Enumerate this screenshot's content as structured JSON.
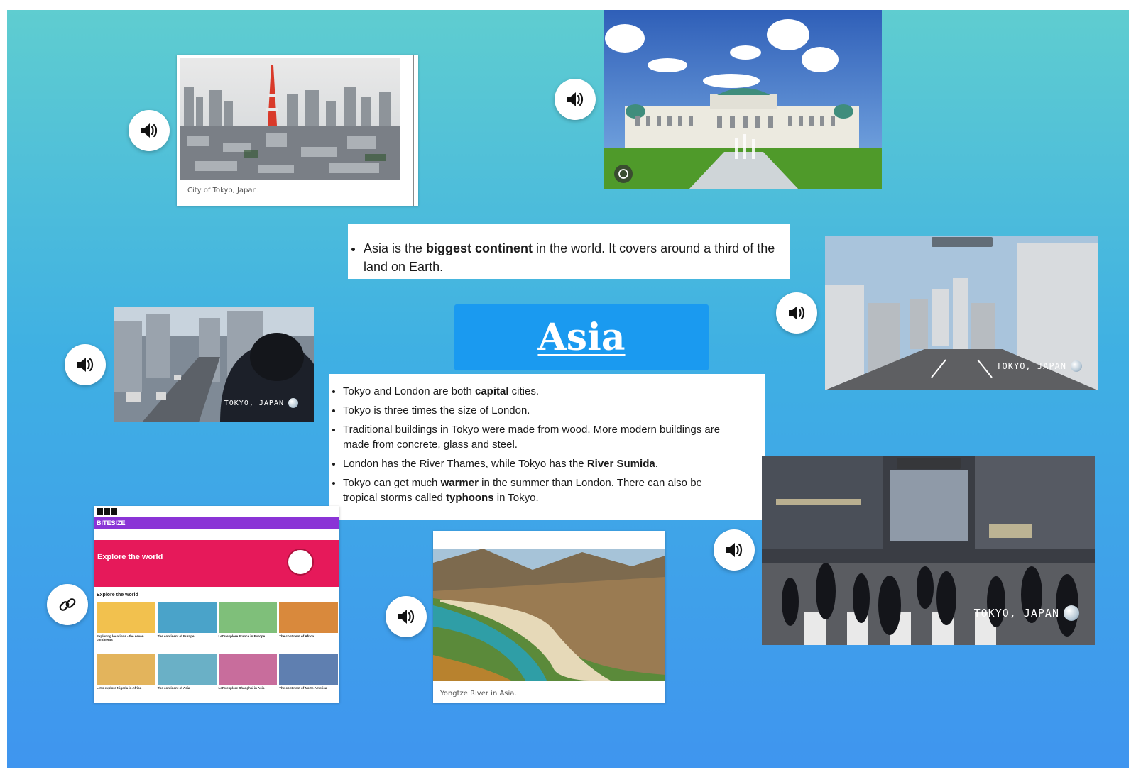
{
  "page_title": "Asia",
  "icons": {
    "audio": "speaker-volume-icon",
    "link": "chain-link-icon",
    "globe": "globe-icon",
    "camera": "camera-switch-icon"
  },
  "colors": {
    "background_top": "#5fcdd0",
    "background_bottom": "#3f95ef",
    "title_box": "#1a9af0",
    "bitesize_purple": "#8a34d6",
    "bitesize_pink": "#e6195a"
  },
  "tokyo_photo": {
    "caption": "City of Tokyo, Japan."
  },
  "river_photo": {
    "caption": "Yongtze River in Asia."
  },
  "video_overlay": {
    "location_label": "TOKYO, JAPAN"
  },
  "intro_fact": {
    "before": "Asia is the ",
    "bold": "biggest continent",
    "after": " in the world. It covers around a third of the land on Earth."
  },
  "facts": [
    {
      "before": "Tokyo and London are both ",
      "bold": "capital",
      "after": " cities."
    },
    {
      "before": "Tokyo is three times the size of London.",
      "bold": "",
      "after": ""
    },
    {
      "before": "Traditional buildings in Tokyo were made from wood. More modern buildings are made from concrete, glass and steel.",
      "bold": "",
      "after": ""
    },
    {
      "before": "London has the River Thames, while Tokyo has the ",
      "bold": "River Sumida",
      "after": "."
    },
    {
      "before": "Tokyo can get much ",
      "bold": "warmer",
      "after": " in the summer than London. There can also be tropical storms called ",
      "bold2": "typhoons",
      "after2": " in Tokyo."
    }
  ],
  "bitesize": {
    "brand": "BITESIZE",
    "hero_title": "Explore the world",
    "section_title": "Explore the world",
    "cards": [
      "Exploring locations - the seven continents",
      "The continent of Europe",
      "Let's explore France in Europe",
      "The continent of Africa",
      "Let's explore Nigeria in Africa",
      "The continent of Asia",
      "Let's explore Shanghai in Asia",
      "The continent of North America"
    ]
  }
}
